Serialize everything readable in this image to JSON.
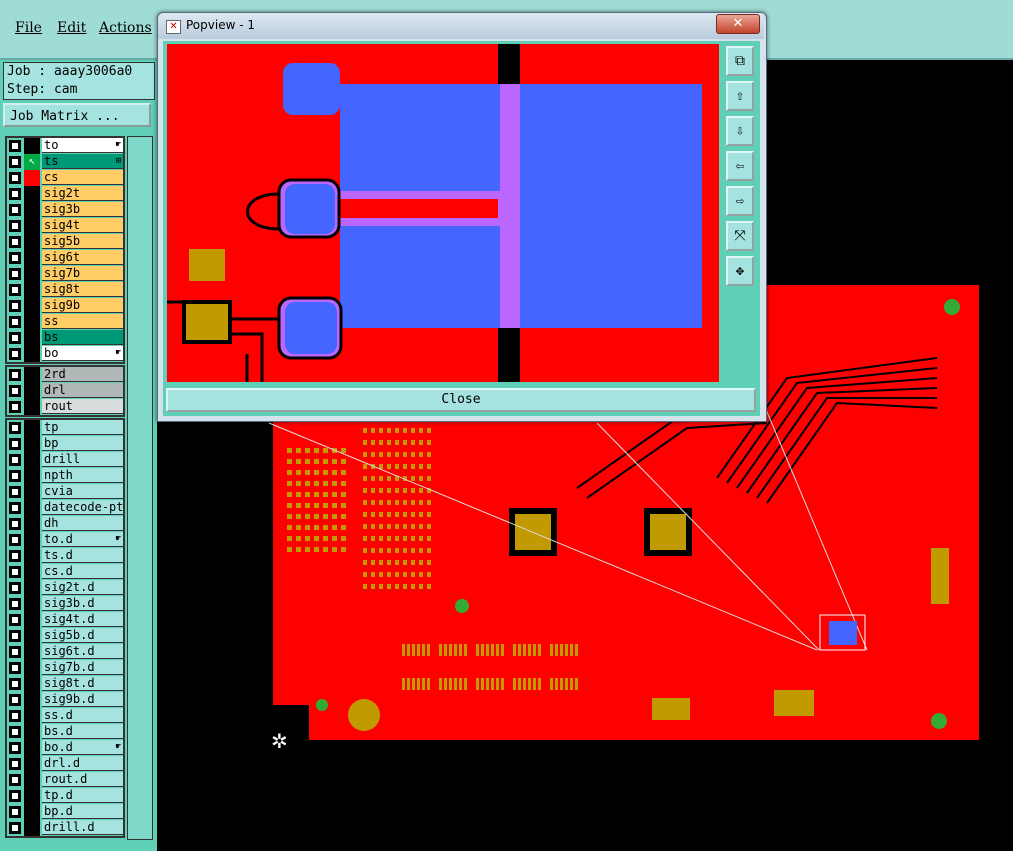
{
  "menu": {
    "file": "File",
    "edit": "Edit",
    "actions": "Actions"
  },
  "info": {
    "job": "Job : aaay3006a0",
    "step": "Step: cam"
  },
  "job_matrix_label": "Job Matrix ...",
  "layers_board": [
    {
      "name": "to",
      "bg": "#ffffff",
      "mark": "☛"
    },
    {
      "name": "ts",
      "bg": "#009977",
      "mark": "⊞",
      "active": true
    },
    {
      "name": "cs",
      "bg": "#ffcc66"
    },
    {
      "name": "sig2t",
      "bg": "#ffcc66"
    },
    {
      "name": "sig3b",
      "bg": "#ffcc66"
    },
    {
      "name": "sig4t",
      "bg": "#ffcc66"
    },
    {
      "name": "sig5b",
      "bg": "#ffcc66"
    },
    {
      "name": "sig6t",
      "bg": "#ffcc66"
    },
    {
      "name": "sig7b",
      "bg": "#ffcc66"
    },
    {
      "name": "sig8t",
      "bg": "#ffcc66"
    },
    {
      "name": "sig9b",
      "bg": "#ffcc66"
    },
    {
      "name": "ss",
      "bg": "#ffcc66"
    },
    {
      "name": "bs",
      "bg": "#009977"
    },
    {
      "name": "bo",
      "bg": "#ffffff",
      "mark": "☛"
    }
  ],
  "layers_drill": [
    {
      "name": "2rd",
      "bg": "#b0b8b8"
    },
    {
      "name": "drl",
      "bg": "#b0b8b8"
    },
    {
      "name": "rout",
      "bg": "#d8dcdc"
    }
  ],
  "layers_misc": [
    {
      "name": "tp"
    },
    {
      "name": "bp"
    },
    {
      "name": "drill"
    },
    {
      "name": "npth"
    },
    {
      "name": "cvia"
    },
    {
      "name": "datecode-pte"
    },
    {
      "name": "dh"
    },
    {
      "name": "to.d",
      "mark": "☛"
    },
    {
      "name": "ts.d"
    },
    {
      "name": "cs.d"
    },
    {
      "name": "sig2t.d"
    },
    {
      "name": "sig3b.d"
    },
    {
      "name": "sig4t.d"
    },
    {
      "name": "sig5b.d"
    },
    {
      "name": "sig6t.d"
    },
    {
      "name": "sig7b.d"
    },
    {
      "name": "sig8t.d"
    },
    {
      "name": "sig9b.d"
    },
    {
      "name": "ss.d"
    },
    {
      "name": "bs.d"
    },
    {
      "name": "bo.d",
      "mark": "☛"
    },
    {
      "name": "drl.d"
    },
    {
      "name": "rout.d"
    },
    {
      "name": "tp.d"
    },
    {
      "name": "bp.d"
    },
    {
      "name": "drill.d"
    }
  ],
  "popview": {
    "title": "Popview - 1",
    "close_x": "✕",
    "close_label": "Close",
    "tools": [
      "⧉",
      "⇧",
      "⇩",
      "⇦",
      "⇨",
      "⤧",
      "✥"
    ]
  },
  "colors": {
    "copper": "#ff0000",
    "pad": "#c09a00",
    "highlight": "#4466ff",
    "trace_hl": "#bb66ff"
  }
}
